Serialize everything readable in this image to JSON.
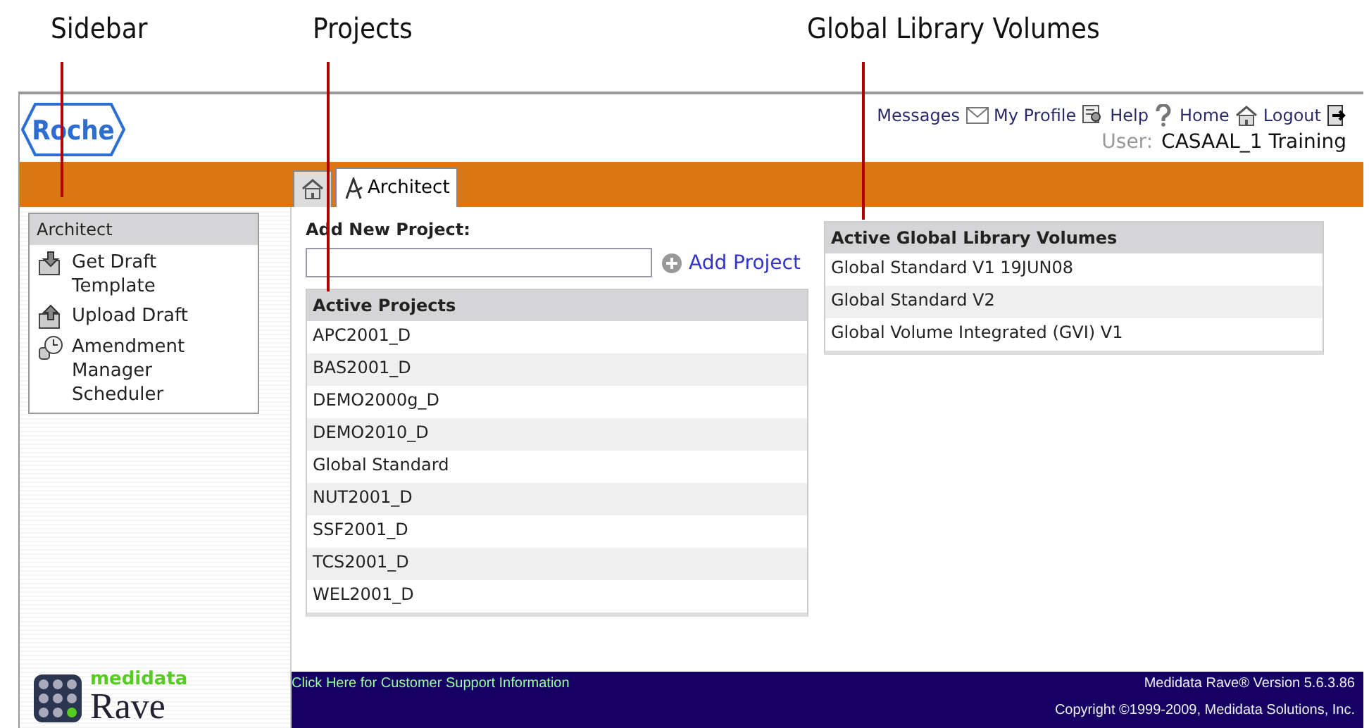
{
  "callouts": [
    {
      "label": "Sidebar"
    },
    {
      "label": "Projects"
    },
    {
      "label": "Global Library Volumes"
    }
  ],
  "header": {
    "logo": "Roche",
    "links": [
      {
        "label": "Messages"
      },
      {
        "label": "My Profile"
      },
      {
        "label": "Help"
      },
      {
        "label": "Home"
      },
      {
        "label": "Logout"
      }
    ],
    "user_label": "User:",
    "user_name": "CASAAL_1 Training"
  },
  "tabs": [
    {
      "kind": "home",
      "selected": false
    },
    {
      "kind": "architect",
      "label": "Architect",
      "selected": true
    }
  ],
  "sidebar": {
    "title": "Architect",
    "items": [
      {
        "label": "Get Draft Template"
      },
      {
        "label": "Upload Draft"
      },
      {
        "label": "Amendment Manager Scheduler"
      }
    ],
    "brand_top": "medidata",
    "brand_bottom": "Rave"
  },
  "add_project": {
    "heading": "Add New Project:",
    "button": "Add Project"
  },
  "projects": {
    "heading": "Active Projects",
    "rows": [
      "APC2001_D",
      "BAS2001_D",
      "DEMO2000g_D",
      "DEMO2010_D",
      "Global Standard",
      "NUT2001_D",
      "SSF2001_D",
      "TCS2001_D",
      "WEL2001_D"
    ]
  },
  "volumes": {
    "heading": "Active Global Library Volumes",
    "rows": [
      "Global Standard V1 19JUN08",
      "Global Standard V2",
      "Global Volume Integrated (GVI) V1"
    ]
  },
  "footer": {
    "support_link": "Click Here for Customer Support Information",
    "version": "Medidata Rave® Version 5.6.3.86",
    "copyright": "Copyright ©1999-2009, Medidata Solutions, Inc."
  }
}
